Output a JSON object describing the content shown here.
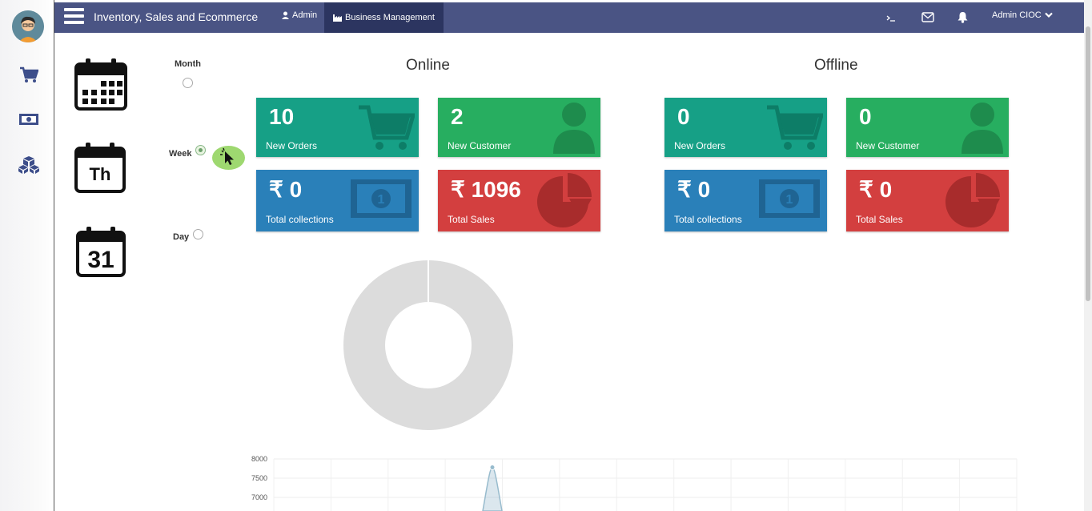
{
  "app": {
    "title": "Inventory, Sales and Ecommerce"
  },
  "nav": {
    "admin": "Admin",
    "business_management": "Business Management",
    "user": "Admin CIOC"
  },
  "sidebar": {
    "icons": [
      "cart-icon",
      "money-icon",
      "cubes-icon"
    ]
  },
  "period": {
    "month_label": "Month",
    "week_label": "Week",
    "day_label": "Day",
    "week_icon_text": "Th",
    "day_icon_text": "31",
    "selected": "Week"
  },
  "online": {
    "title": "Online",
    "new_orders": {
      "value": "10",
      "label": "New Orders"
    },
    "new_customer": {
      "value": "2",
      "label": "New Customer"
    },
    "total_collections": {
      "value": "₹ 0",
      "label": "Total collections"
    },
    "total_sales": {
      "value": "₹ 1096",
      "label": "Total Sales"
    }
  },
  "offline": {
    "title": "Offline",
    "new_orders": {
      "value": "0",
      "label": "New Orders"
    },
    "new_customer": {
      "value": "0",
      "label": "New Customer"
    },
    "total_collections": {
      "value": "₹ 0",
      "label": "Total collections"
    },
    "total_sales": {
      "value": "₹ 0",
      "label": "Total Sales"
    }
  },
  "colors": {
    "topbar": "#4a5484",
    "teal": "#16a086",
    "green": "#27ae60",
    "blue": "#2a80b9",
    "red": "#d33f3f"
  },
  "chart_data": [
    {
      "type": "pie",
      "values": [
        1
      ],
      "colors": [
        "#dcdcdc"
      ]
    },
    {
      "type": "line",
      "y_ticks": [
        "8000",
        "7500",
        "7000"
      ],
      "ylim": [
        7000,
        8000
      ],
      "peak": 7780,
      "grid": true
    }
  ]
}
